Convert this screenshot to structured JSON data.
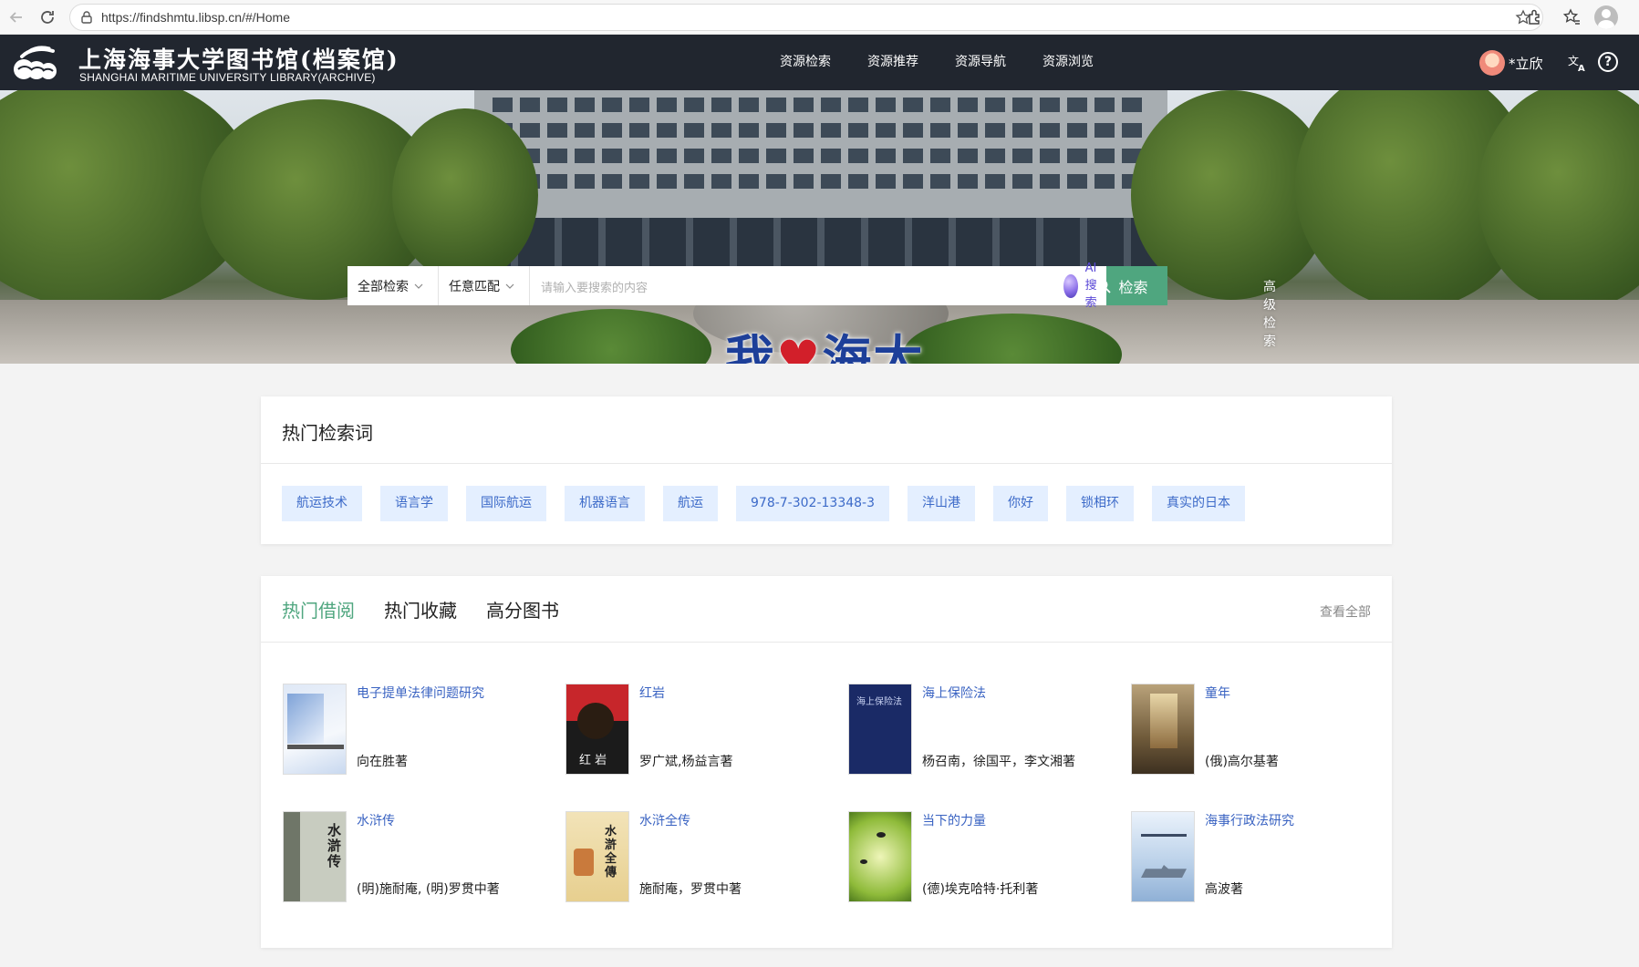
{
  "browser": {
    "url": "https://findshmtu.libsp.cn/#/Home"
  },
  "header": {
    "logo_cn": "上海海事大学图书馆(档案馆)",
    "logo_en": "SHANGHAI MARITIME UNIVERSITY LIBRARY(ARCHIVE)",
    "nav": [
      "资源检索",
      "资源推荐",
      "资源导航",
      "资源浏览"
    ],
    "user_name": "*立欣"
  },
  "hero": {
    "slogan_pre": "我",
    "slogan_post": "海大"
  },
  "search": {
    "scope": "全部检索",
    "match": "任意匹配",
    "placeholder": "请输入要搜索的内容",
    "ai_label": "AI搜索",
    "button_label": "检索",
    "advanced_label": "高级检索"
  },
  "hot_terms": {
    "title": "热门检索词",
    "tags": [
      "航运技术",
      "语言学",
      "国际航运",
      "机器语言",
      "航运",
      "978-7-302-13348-3",
      "洋山港",
      "你好",
      "锁相环",
      "真实的日本"
    ]
  },
  "books": {
    "tabs": [
      "热门借阅",
      "热门收藏",
      "高分图书"
    ],
    "active_tab": "热门借阅",
    "view_all": "查看全部",
    "items": [
      {
        "title": "电子提单法律问题研究",
        "author": "向在胜著"
      },
      {
        "title": "红岩",
        "author": "罗广斌,杨益言著"
      },
      {
        "title": "海上保险法",
        "author": "杨召南，徐国平，李文湘著"
      },
      {
        "title": "童年",
        "author": "(俄)高尔基著"
      },
      {
        "title": "水浒传",
        "author": "(明)施耐庵, (明)罗贯中著"
      },
      {
        "title": "水浒全传",
        "author": "施耐庵，罗贯中著"
      },
      {
        "title": "当下的力量",
        "author": "(德)埃克哈特·托利著"
      },
      {
        "title": "海事行政法研究",
        "author": "高波著"
      }
    ]
  },
  "colors": {
    "header_bg": "#21262f",
    "accent_green": "#4fa67f",
    "tag_bg": "#e4efff",
    "link_blue": "#3a63c2"
  }
}
